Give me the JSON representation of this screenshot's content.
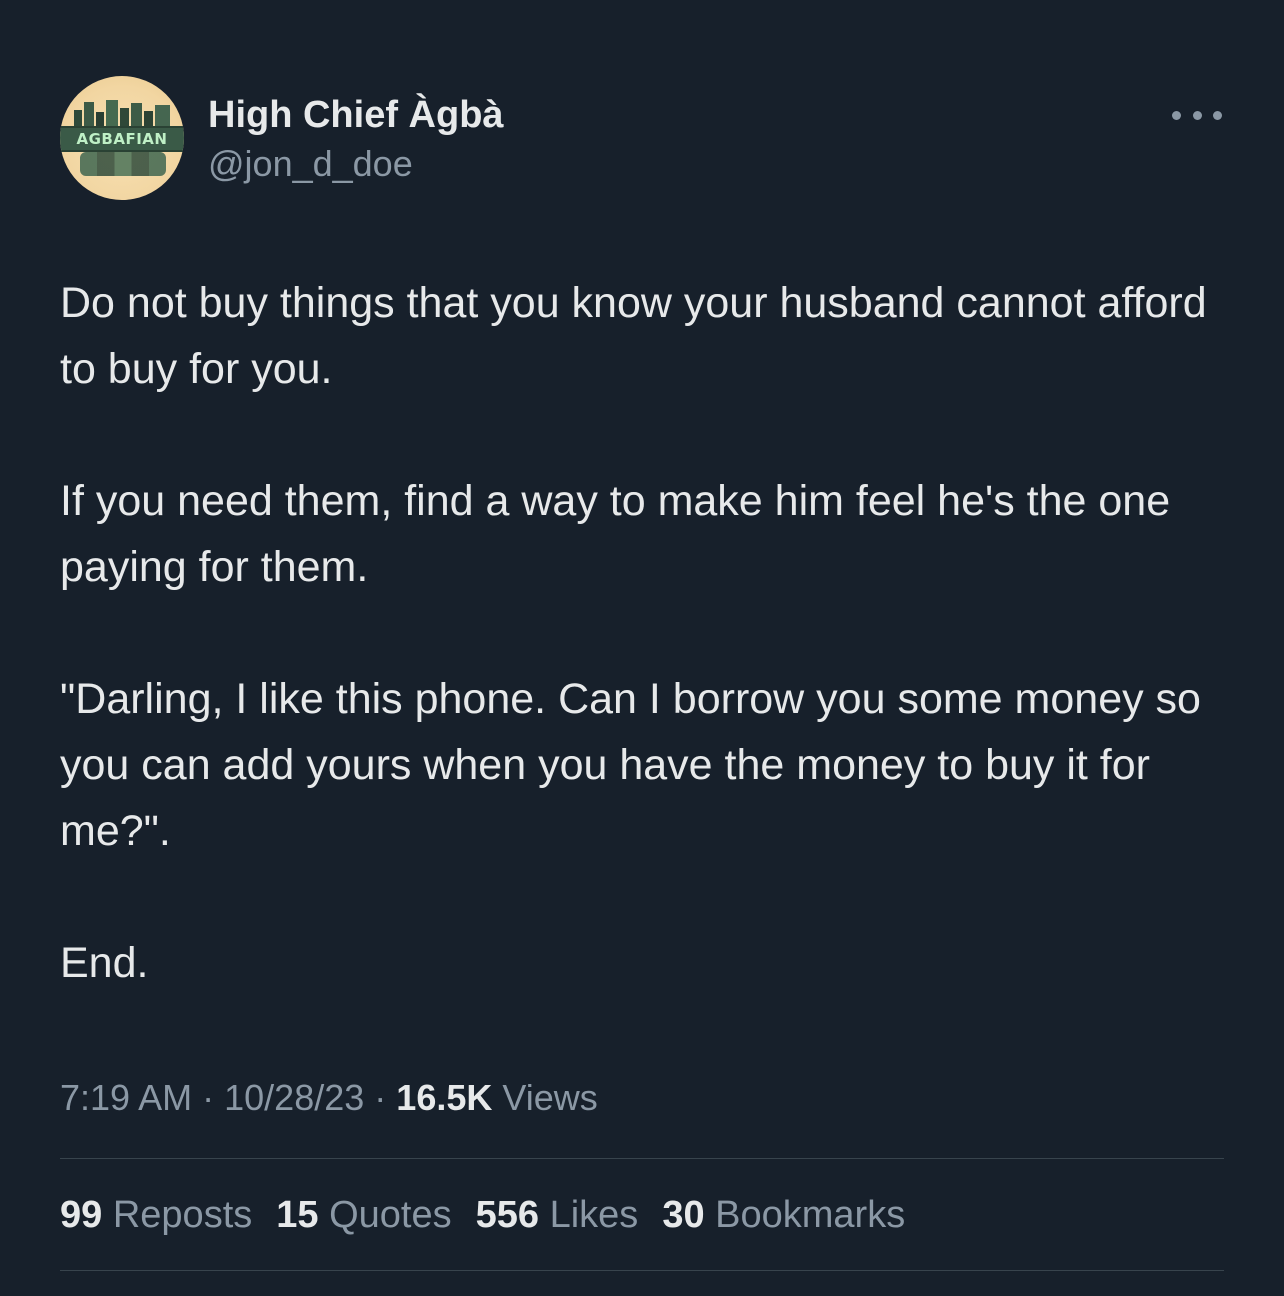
{
  "user": {
    "display_name": "High Chief Àgbà",
    "handle": "@jon_d_doe",
    "avatar_text": "AGBAFIAN"
  },
  "tweet": {
    "paragraphs": [
      "Do not buy things that you know your husband cannot afford to buy for you.",
      "If you need them, find a way to make him feel he's the one paying for them.",
      "\"Darling, I like this phone. Can I borrow you some money so you can add yours when you have the money to buy it for me?\".",
      "End."
    ],
    "time": "7:19 AM",
    "separator": "·",
    "date": "10/28/23",
    "views_count": "16.5K",
    "views_label": "Views"
  },
  "stats": {
    "reposts_count": "99",
    "reposts_label": "Reposts",
    "quotes_count": "15",
    "quotes_label": "Quotes",
    "likes_count": "556",
    "likes_label": "Likes",
    "bookmarks_count": "30",
    "bookmarks_label": "Bookmarks"
  },
  "colors": {
    "background": "#17202b",
    "text_primary": "#e7e9ea",
    "text_secondary": "#8b98a5",
    "divider": "#38444d"
  },
  "icons": {
    "more": "more-horizontal-icon"
  }
}
